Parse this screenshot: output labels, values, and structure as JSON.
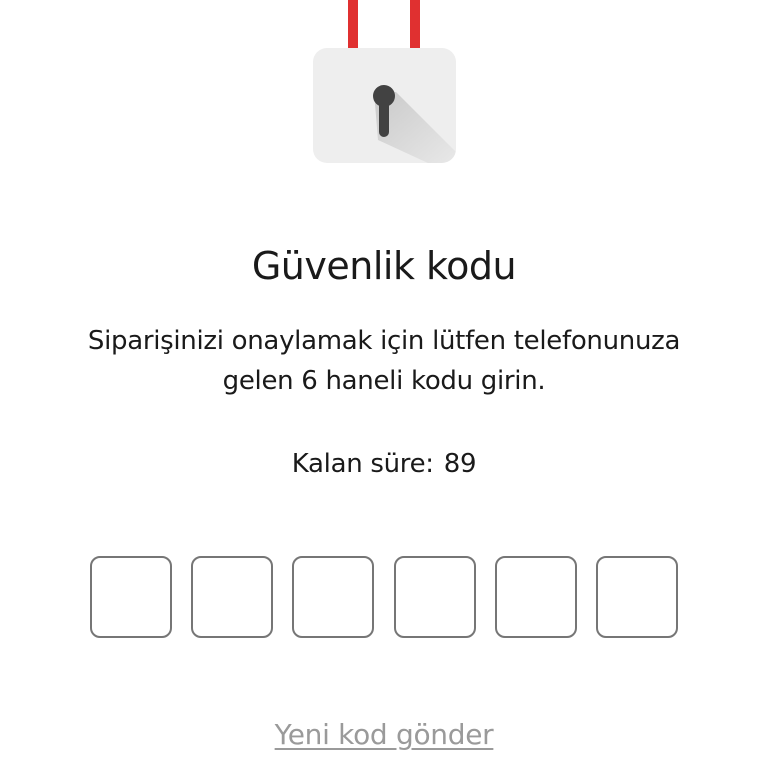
{
  "header": {
    "icon": "padlock-icon",
    "title": "Güvenlik kodu",
    "description": "Siparişinizi onaylamak için lütfen telefonunuza gelen 6 haneli kodu girin."
  },
  "timer": {
    "label": "Kalan süre:",
    "value": "89"
  },
  "code_inputs": [
    {
      "value": ""
    },
    {
      "value": ""
    },
    {
      "value": ""
    },
    {
      "value": ""
    },
    {
      "value": ""
    },
    {
      "value": ""
    }
  ],
  "resend_link": {
    "label": "Yeni kod gönder"
  },
  "colors": {
    "shackle": "#e03030",
    "lock_body": "#eeeeee",
    "keyhole": "#424242",
    "box_border": "#767676",
    "link": "#9a9a9a"
  }
}
